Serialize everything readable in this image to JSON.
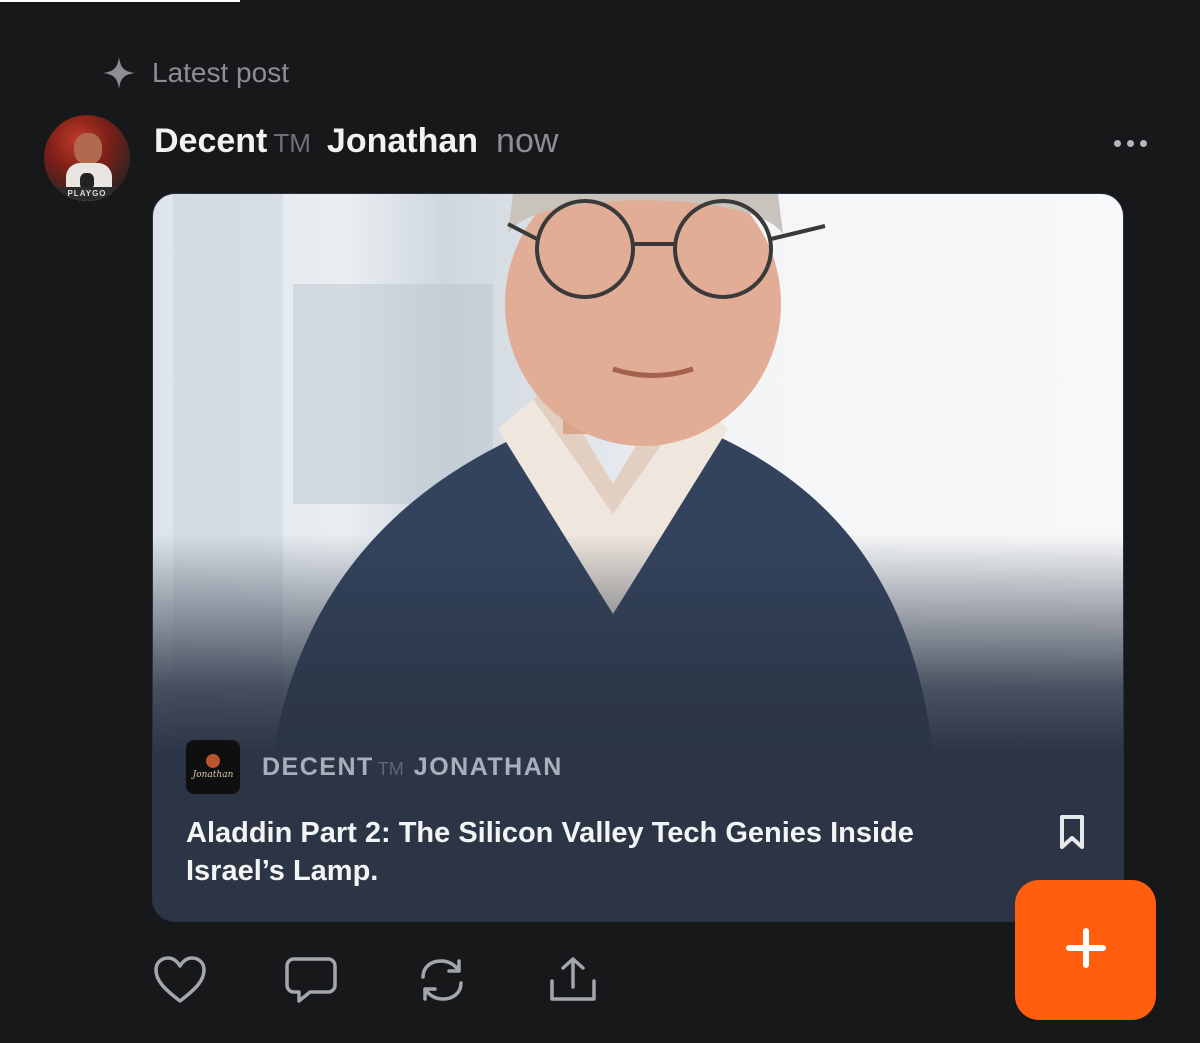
{
  "header": {
    "section_label": "Latest post",
    "section_icon": "sparkle-icon"
  },
  "post": {
    "author_first": "Decent",
    "author_tm": "TM",
    "author_last": "Jonathan",
    "time": "now",
    "avatar_caption": "PLAYGO"
  },
  "card": {
    "publication_first": "DECENT",
    "publication_tm": "TM",
    "publication_last": "JONATHAN",
    "publication_logo_text": "Jonathan",
    "title": "Aladdin Part 2: The Silicon Valley Tech Genies Inside Israel’s Lamp."
  },
  "actions": [
    "heart-icon",
    "comment-icon",
    "repost-icon",
    "share-icon"
  ],
  "fab": {
    "icon": "plus-icon",
    "color": "#ff5e0e"
  }
}
